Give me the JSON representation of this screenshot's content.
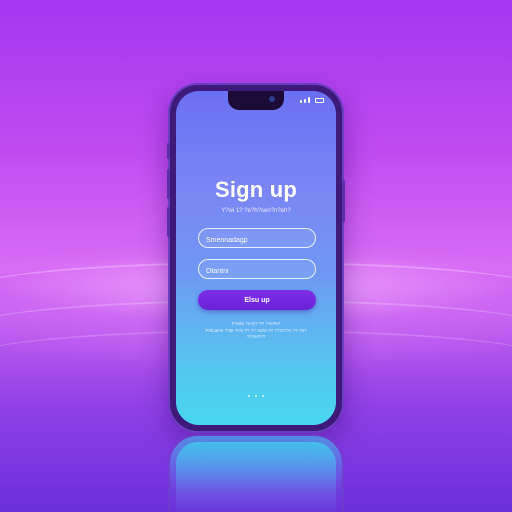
{
  "screen": {
    "title": "Sign up",
    "subtitle": "Y?wi 1? ?e?h?sen?n?eh?",
    "fields": [
      {
        "placeholder": "Smennadagp"
      },
      {
        "placeholder": "Otantni"
      }
    ],
    "button_label": "Elsu up",
    "fine_print": [
      "F?ebs ?n?y? ?? ??e?e?",
      "Prttcat?e ??te ?t?s ?? ?? ?a?e ?? ???c??n ?? ?n?",
      "???e?i??"
    ]
  },
  "colors": {
    "background": "#c04cf0",
    "screen_top": "#6a6ff2",
    "screen_bottom": "#47d6ee",
    "button": "#7d2ee6"
  }
}
